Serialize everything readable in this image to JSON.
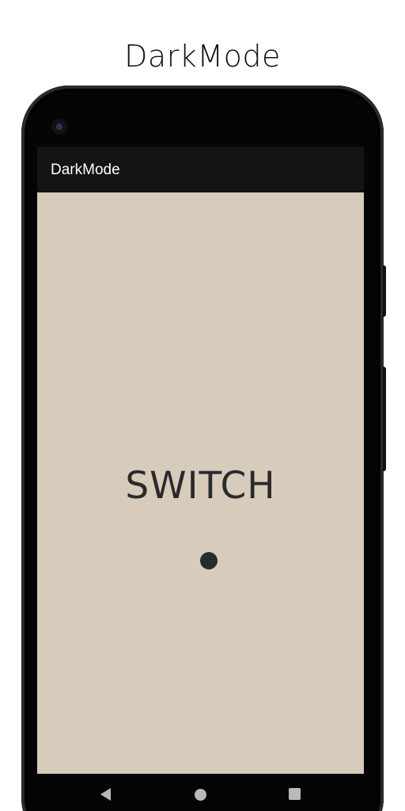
{
  "store": {
    "title": "DarkMode"
  },
  "app_bar": {
    "title": "DarkMode"
  },
  "main": {
    "switch_label": "SWITCH",
    "toggle_on": false
  },
  "nav": {
    "back_icon": "back-triangle-icon",
    "home_icon": "home-circle-icon",
    "recents_icon": "recents-square-icon"
  },
  "colors": {
    "screen_background": "#d7cbbb",
    "app_bar_background": "#141414",
    "text_dark": "#2a2a2a",
    "nav_icons": "#b9b9b9"
  }
}
